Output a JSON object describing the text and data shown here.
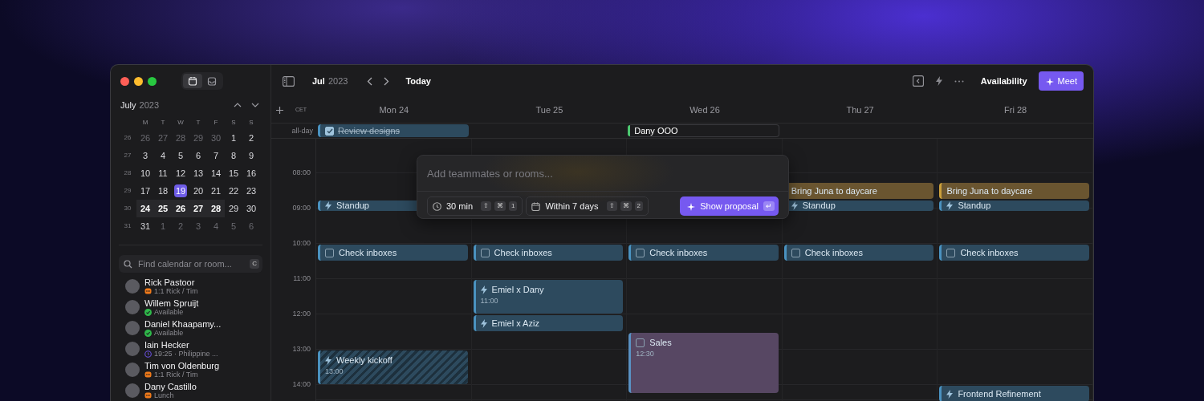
{
  "window": {
    "controls": [
      {
        "color": "#ff5f57"
      },
      {
        "color": "#febc2e"
      },
      {
        "color": "#28c840"
      }
    ]
  },
  "sidebar": {
    "views": [
      {
        "kind": "calendar",
        "selected": true
      },
      {
        "kind": "inbox",
        "selected": false
      }
    ],
    "month": "July",
    "year": "2023",
    "weekday_headers": [
      "M",
      "T",
      "W",
      "T",
      "F",
      "S",
      "S"
    ],
    "weeks": [
      {
        "number": "26",
        "days": [
          {
            "label": "26",
            "outside": true,
            "selected": false,
            "in_view": false
          },
          {
            "label": "27",
            "outside": true,
            "selected": false,
            "in_view": false
          },
          {
            "label": "28",
            "outside": true,
            "selected": false,
            "in_view": false
          },
          {
            "label": "29",
            "outside": true,
            "selected": false,
            "in_view": false
          },
          {
            "label": "30",
            "outside": true,
            "selected": false,
            "in_view": false
          },
          {
            "label": "1",
            "outside": false,
            "selected": false,
            "in_view": false
          },
          {
            "label": "2",
            "outside": false,
            "selected": false,
            "in_view": false
          }
        ]
      },
      {
        "number": "27",
        "days": [
          {
            "label": "3",
            "outside": false,
            "selected": false,
            "in_view": false
          },
          {
            "label": "4",
            "outside": false,
            "selected": false,
            "in_view": false
          },
          {
            "label": "5",
            "outside": false,
            "selected": false,
            "in_view": false
          },
          {
            "label": "6",
            "outside": false,
            "selected": false,
            "in_view": false
          },
          {
            "label": "7",
            "outside": false,
            "selected": false,
            "in_view": false
          },
          {
            "label": "8",
            "outside": false,
            "selected": false,
            "in_view": false
          },
          {
            "label": "9",
            "outside": false,
            "selected": false,
            "in_view": false
          }
        ]
      },
      {
        "number": "28",
        "days": [
          {
            "label": "10",
            "outside": false,
            "selected": false,
            "in_view": false
          },
          {
            "label": "11",
            "outside": false,
            "selected": false,
            "in_view": false
          },
          {
            "label": "12",
            "outside": false,
            "selected": false,
            "in_view": false
          },
          {
            "label": "13",
            "outside": false,
            "selected": false,
            "in_view": false
          },
          {
            "label": "14",
            "outside": false,
            "selected": false,
            "in_view": false
          },
          {
            "label": "15",
            "outside": false,
            "selected": false,
            "in_view": false
          },
          {
            "label": "16",
            "outside": false,
            "selected": false,
            "in_view": false
          }
        ]
      },
      {
        "number": "29",
        "days": [
          {
            "label": "17",
            "outside": false,
            "selected": false,
            "in_view": false
          },
          {
            "label": "18",
            "outside": false,
            "selected": false,
            "in_view": false
          },
          {
            "label": "19",
            "outside": false,
            "selected": true,
            "in_view": false
          },
          {
            "label": "20",
            "outside": false,
            "selected": false,
            "in_view": false
          },
          {
            "label": "21",
            "outside": false,
            "selected": false,
            "in_view": false
          },
          {
            "label": "22",
            "outside": false,
            "selected": false,
            "in_view": false
          },
          {
            "label": "23",
            "outside": false,
            "selected": false,
            "in_view": false
          }
        ]
      },
      {
        "number": "30",
        "days": [
          {
            "label": "24",
            "outside": false,
            "selected": false,
            "in_view": true
          },
          {
            "label": "25",
            "outside": false,
            "selected": false,
            "in_view": true
          },
          {
            "label": "26",
            "outside": false,
            "selected": false,
            "in_view": true
          },
          {
            "label": "27",
            "outside": false,
            "selected": false,
            "in_view": true
          },
          {
            "label": "28",
            "outside": false,
            "selected": false,
            "in_view": true
          },
          {
            "label": "29",
            "outside": false,
            "selected": false,
            "in_view": false
          },
          {
            "label": "30",
            "outside": false,
            "selected": false,
            "in_view": false
          }
        ]
      },
      {
        "number": "31",
        "days": [
          {
            "label": "31",
            "outside": false,
            "selected": false,
            "in_view": false
          },
          {
            "label": "1",
            "outside": true,
            "selected": false,
            "in_view": false
          },
          {
            "label": "2",
            "outside": true,
            "selected": false,
            "in_view": false
          },
          {
            "label": "3",
            "outside": true,
            "selected": false,
            "in_view": false
          },
          {
            "label": "4",
            "outside": true,
            "selected": false,
            "in_view": false
          },
          {
            "label": "5",
            "outside": true,
            "selected": false,
            "in_view": false
          },
          {
            "label": "6",
            "outside": true,
            "selected": false,
            "in_view": false
          }
        ]
      }
    ],
    "search": {
      "placeholder": "Find calendar or room...",
      "shortcut": "C"
    },
    "people": [
      {
        "name": "Rick Pastoor",
        "status": {
          "kind": "event",
          "text": "1:1 Rick / Tim"
        }
      },
      {
        "name": "Willem Spruijt",
        "status": {
          "kind": "available",
          "text": "Available"
        }
      },
      {
        "name": "Daniel Khaapamy...",
        "status": {
          "kind": "available",
          "text": "Available"
        }
      },
      {
        "name": "Iain Hecker",
        "status": {
          "kind": "time",
          "text": "19:25 · Philippine ..."
        }
      },
      {
        "name": "Tim von Oldenburg",
        "status": {
          "kind": "event",
          "text": "1:1 Rick / Tim"
        }
      },
      {
        "name": "Dany Castillo",
        "status": {
          "kind": "event",
          "text": "Lunch"
        }
      }
    ]
  },
  "toolbar": {
    "month": "Jul",
    "year": "2023",
    "today": "Today",
    "availability": "Availability",
    "meet": "Meet"
  },
  "calendar": {
    "timezone": "CET",
    "all_day_label": "all-day",
    "hours": [
      "08:00",
      "09:00",
      "10:00",
      "11:00",
      "12:00",
      "13:00",
      "14:00"
    ],
    "days": [
      {
        "label": "Mon 24",
        "all_day": [
          {
            "kind": "task",
            "title": "Review designs",
            "done": true,
            "color": "#2d4a5e"
          }
        ],
        "events": [
          {
            "kind": "meeting",
            "title": "Standup",
            "color": "#2d4a5e",
            "tentative": false
          },
          {
            "kind": "task",
            "title": "Check inboxes",
            "color": "#2d4a5e",
            "tentative": false,
            "done": false
          },
          {
            "kind": "meeting",
            "title": "Weekly kickoff",
            "time": "13:00",
            "color": "#2d4a5e",
            "tentative": true
          }
        ]
      },
      {
        "label": "Tue 25",
        "events": [
          {
            "kind": "task",
            "title": "Check inboxes",
            "color": "#2d4a5e",
            "tentative": false,
            "done": false
          },
          {
            "kind": "meeting",
            "title": "Emiel x Dany",
            "time": "11:00",
            "color": "#2d4a5e",
            "tentative": false
          },
          {
            "kind": "meeting",
            "title": "Emiel x Aziz",
            "color": "#2d4a5e",
            "tentative": false
          }
        ]
      },
      {
        "label": "Wed 26",
        "all_day": [
          {
            "kind": "out_of_office",
            "title": "Dany OOO",
            "color": "#4cc870"
          }
        ],
        "events": [
          {
            "kind": "task",
            "title": "Check inboxes",
            "color": "#2d4a5e",
            "tentative": false,
            "done": false
          },
          {
            "kind": "task",
            "title": "Sales",
            "time": "12:30",
            "color": "#574763",
            "tentative": false,
            "done": false
          }
        ]
      },
      {
        "label": "Thu 27",
        "events": [
          {
            "kind": "plain",
            "title": "Bring Juna to daycare",
            "color": "#6a5530",
            "tentative": false
          },
          {
            "kind": "meeting",
            "title": "Standup",
            "color": "#2d4a5e",
            "tentative": false
          },
          {
            "kind": "task",
            "title": "Check inboxes",
            "color": "#2d4a5e",
            "tentative": false,
            "done": false
          }
        ]
      },
      {
        "label": "Fri 28",
        "events": [
          {
            "kind": "plain",
            "title": "Bring Juna to daycare",
            "color": "#6a5530",
            "tentative": false
          },
          {
            "kind": "meeting",
            "title": "Standup",
            "color": "#2d4a5e",
            "tentative": false
          },
          {
            "kind": "task",
            "title": "Check inboxes",
            "color": "#2d4a5e",
            "tentative": false,
            "done": false
          },
          {
            "kind": "meeting",
            "title": "Frontend Refinement",
            "color": "#2d4a5e",
            "tentative": false
          }
        ]
      }
    ]
  },
  "composer": {
    "placeholder": "Add teammates or rooms...",
    "options": [
      {
        "kind": "duration",
        "label": "30 min",
        "keys": [
          "⇧",
          "⌘",
          "1"
        ]
      },
      {
        "kind": "range",
        "label": "Within 7 days",
        "keys": [
          "⇧",
          "⌘",
          "2"
        ]
      }
    ],
    "button": "Show proposal",
    "button_key": "↵"
  }
}
